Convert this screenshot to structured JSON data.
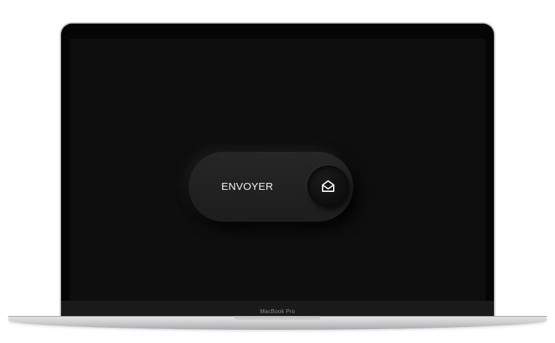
{
  "device": {
    "model_label": "MacBook Pro"
  },
  "screen": {
    "background_color": "#0e0e0e",
    "send_button": {
      "label": "ENVOYER",
      "icon": "envelope-open-icon"
    }
  }
}
